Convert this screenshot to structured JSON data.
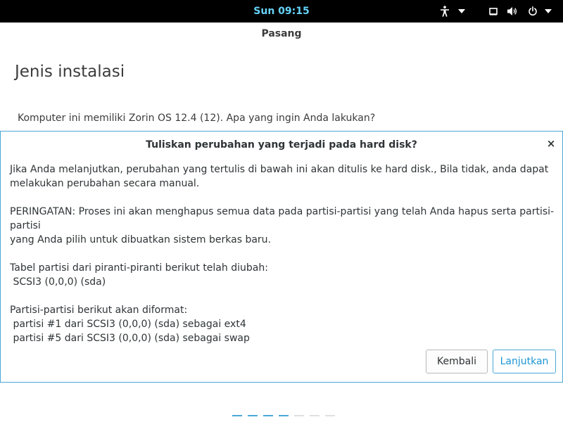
{
  "topbar": {
    "clock": "Sun 09:15",
    "icons": [
      "accessibility-icon",
      "chevron-down-icon",
      "display-icon",
      "volume-icon",
      "power-icon",
      "chevron-down-icon"
    ]
  },
  "window": {
    "title": "Pasang",
    "heading": "Jenis instalasi",
    "question": "Komputer ini memiliki Zorin OS 12.4 (12). Apa yang ingin Anda lakukan?"
  },
  "dialog": {
    "title": "Tuliskan perubahan yang terjadi pada hard disk?",
    "close_label": "×",
    "paragraphs": [
      "Jika Anda melanjutkan, perubahan yang tertulis di bawah ini akan ditulis ke hard disk., Bila tidak, anda dapat\nmelakukan perubahan secara manual.",
      "PERINGATAN: Proses ini akan menghapus semua data pada partisi-partisi yang telah Anda hapus serta partisi-partisi\nyang Anda pilih untuk dibuatkan sistem berkas baru.",
      "Tabel partisi dari piranti-piranti berikut telah diubah:\n SCSI3 (0,0,0) (sda)",
      "Partisi-partisi berikut akan diformat:\n partisi #1 dari SCSI3 (0,0,0) (sda) sebagai ext4\n partisi #5 dari SCSI3 (0,0,0) (sda) sebagai swap"
    ],
    "back_label": "Kembali",
    "continue_label": "Lanjutkan"
  },
  "progress": {
    "total_steps": 7,
    "completed_steps": 4
  },
  "colors": {
    "topbar_bg": "#000000",
    "clock": "#66d3fa",
    "accent": "#4aa8d8",
    "step_done": "#4aa8d8",
    "step_todo": "#e0e0e0"
  }
}
